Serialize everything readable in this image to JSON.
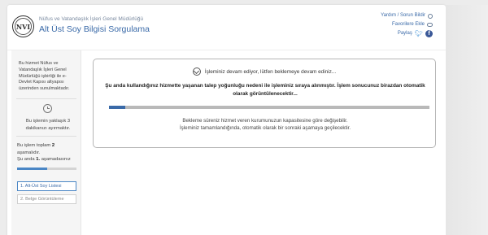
{
  "header": {
    "logo_text": "NVI",
    "organization": "Nüfus ve Vatandaşlık İşleri Genel Müdürlüğü",
    "service_title": "Alt Üst Soy Bilgisi Sorgulama",
    "links": {
      "help_contact": "Yardım / Sorun Bildir",
      "add_favorites": "Favorilere Ekle",
      "share": "Paylaş"
    }
  },
  "sidebar": {
    "intro": "Bu hizmet Nüfus ve Vatandaşlık İşleri Genel Müdürlüğü işbirliği ile e-Devlet Kapısı altyapısı üzerinden sunulmaktadır.",
    "duration": "Bu işlemin yaklaşık 3 dakikanızı ayırmaktır.",
    "steps_total_prefix": "Bu işlem toplam",
    "steps_total_value": "2",
    "steps_total_suffix": "aşamalıdır.",
    "steps_current_prefix": "Şu anda",
    "steps_current_value": "1.",
    "steps_current_suffix": "aşamadasınız",
    "step_progress": 0.5,
    "steps": [
      {
        "label": "1. Alt-Üst Soy Listesi"
      },
      {
        "label": "2. Belge Görüntüleme"
      }
    ]
  },
  "notice": {
    "status_line": "İşleminiz devam ediyor, lütfen beklemeye devam ediniz...",
    "main_message": "Şu anda kullandığınız hizmette yaşanan talep yoğunluğu nedeni ile işleminiz sıraya alınmıştır. İşlem sonucunuz birazdan otomatik olarak görüntülenecektir...",
    "progress": 0.05,
    "footer_line1": "Bekleme süreniz hizmet veren kurumunuzun kapasitesine göre değişebilir.",
    "footer_line2": "İşleminiz tamamlandığında, otomatik olarak bir sonraki aşamaya geçilecektir."
  },
  "colors": {
    "accent": "#3a6aa8",
    "page_bg": "#ececec",
    "progress_track": "#b9b9b9"
  }
}
